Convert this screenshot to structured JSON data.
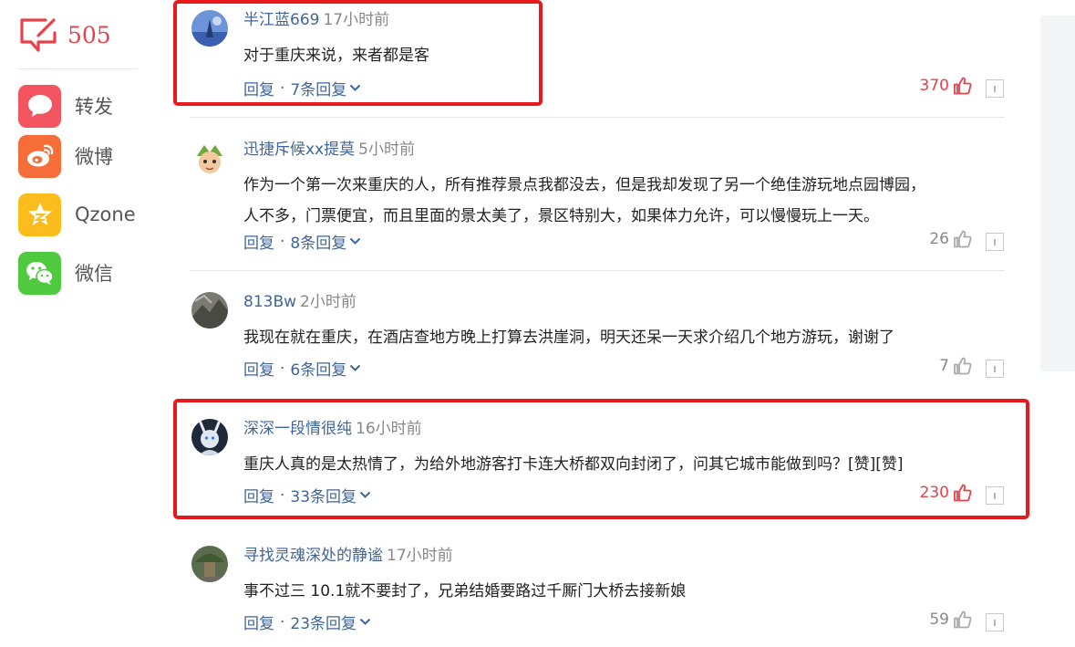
{
  "sidebar": {
    "comment_count": "505",
    "share_items": [
      {
        "label": "转发",
        "icon": "chat-bubble-icon",
        "color": "#f2555f"
      },
      {
        "label": "微博",
        "icon": "weibo-icon",
        "color": "#f66d3a"
      },
      {
        "label": "Qzone",
        "icon": "qzone-star-icon",
        "color": "#fbbd1e"
      },
      {
        "label": "微信",
        "icon": "wechat-icon",
        "color": "#4fc93e"
      }
    ]
  },
  "colors": {
    "accent_red": "#e6424b",
    "username_blue": "#406599",
    "highlight_red": "#e8191c"
  },
  "comments": [
    {
      "user": "半江蓝669",
      "time": "17小时前",
      "lines": [
        "对于重庆来说，来者都是客"
      ],
      "reply_label": "回复",
      "reply_count": "7条回复",
      "likes": "370",
      "liked": true
    },
    {
      "user": "迅捷斥候xx提莫",
      "time": "5小时前",
      "lines": [
        "作为一个第一次来重庆的人，所有推荐景点我都没去，但是我却发现了另一个绝佳游玩地点园博园，",
        "人不多，门票便宜，而且里面的景太美了，景区特别大，如果体力允许，可以慢慢玩上一天。"
      ],
      "reply_label": "回复",
      "reply_count": "8条回复",
      "likes": "26",
      "liked": false
    },
    {
      "user": "813Bw",
      "time": "2小时前",
      "lines": [
        "我现在就在重庆，在酒店查地方晚上打算去洪崖洞，明天还呆一天求介绍几个地方游玩，谢谢了"
      ],
      "reply_label": "回复",
      "reply_count": "6条回复",
      "likes": "7",
      "liked": false
    },
    {
      "user": "深深一段情很纯",
      "time": "16小时前",
      "lines": [
        "重庆人真的是太热情了，为给外地游客打卡连大桥都双向封闭了，问其它城市能做到吗？[赞][赞]"
      ],
      "reply_label": "回复",
      "reply_count": "33条回复",
      "likes": "230",
      "liked": true
    },
    {
      "user": "寻找灵魂深处的静谧",
      "time": "17小时前",
      "lines": [
        "事不过三 10.1就不要封了，兄弟结婚要路过千厮门大桥去接新娘"
      ],
      "reply_label": "回复",
      "reply_count": "23条回复",
      "likes": "59",
      "liked": false
    }
  ]
}
